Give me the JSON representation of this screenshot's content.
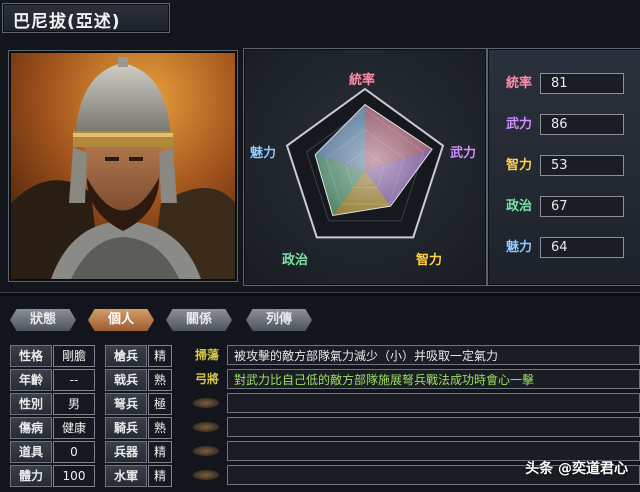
{
  "officer": {
    "name": "巴尼拔(亞述)"
  },
  "radar": {
    "labels": {
      "top": "統率",
      "right": "武力",
      "bottom_right": "智力",
      "bottom_left": "政治",
      "left": "魅力"
    },
    "values": [
      81,
      86,
      53,
      67,
      64
    ],
    "max": 100
  },
  "stats": [
    {
      "label": "統率",
      "value": "81",
      "color": "#ff8ca8"
    },
    {
      "label": "武力",
      "value": "86",
      "color": "#d090ff"
    },
    {
      "label": "智力",
      "value": "53",
      "color": "#ffd24a"
    },
    {
      "label": "政治",
      "value": "67",
      "color": "#7ee0a8"
    },
    {
      "label": "魅力",
      "value": "64",
      "color": "#8fc8ff"
    }
  ],
  "tabs": [
    {
      "label": "狀態",
      "active": false
    },
    {
      "label": "個人",
      "active": true
    },
    {
      "label": "關係",
      "active": false
    },
    {
      "label": "列傳",
      "active": false
    }
  ],
  "profile": [
    {
      "label": "性格",
      "value": "剛膽"
    },
    {
      "label": "年齡",
      "value": "--"
    },
    {
      "label": "性別",
      "value": "男"
    },
    {
      "label": "傷病",
      "value": "健康"
    },
    {
      "label": "道具",
      "value": "0"
    },
    {
      "label": "體力",
      "value": "100"
    }
  ],
  "troops": [
    {
      "label": "槍兵",
      "value": "精"
    },
    {
      "label": "戟兵",
      "value": "熟"
    },
    {
      "label": "弩兵",
      "value": "極"
    },
    {
      "label": "騎兵",
      "value": "熟"
    },
    {
      "label": "兵器",
      "value": "精"
    },
    {
      "label": "水軍",
      "value": "精"
    }
  ],
  "skills": [
    {
      "name": "掃蕩",
      "desc": "被攻擊的敵方部隊氣力減少（小）并吸取一定氣力"
    },
    {
      "name": "弓將",
      "desc": "對武力比自己低的敵方部隊施展弩兵戰法成功時會心一擊"
    },
    {
      "name": "",
      "desc": ""
    },
    {
      "name": "",
      "desc": ""
    },
    {
      "name": "",
      "desc": ""
    },
    {
      "name": "",
      "desc": ""
    }
  ],
  "watermark": "头条 @奕道君心"
}
